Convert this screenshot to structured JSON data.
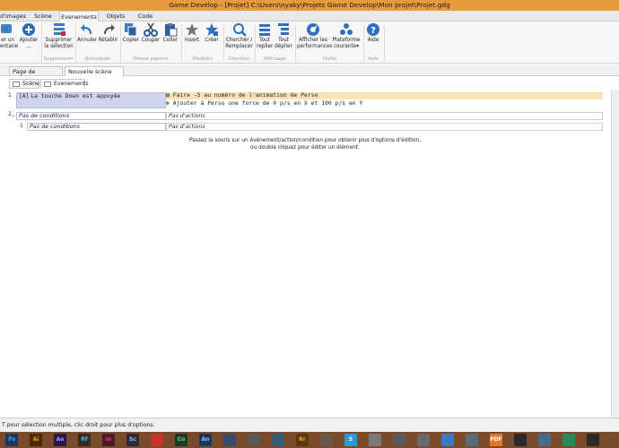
{
  "window": {
    "title": "Game Develop - [Projet] C:\\Users\\nyaky\\Projets Game Develop\\Mon projet\\Projet.gdg"
  },
  "menubar": {
    "tabs": [
      "d'images",
      "Scène",
      "Evenements",
      "Objets",
      "Code"
    ],
    "active": "Evenements"
  },
  "ribbon": {
    "buttons": {
      "ajouter_un_commentaire": [
        "er un",
        "entaire"
      ],
      "ajouter": [
        "Ajouter",
        "..."
      ],
      "supprimer": [
        "Supprimer",
        "la sélection"
      ],
      "annuler": [
        "Annuler"
      ],
      "retablir": [
        "Rétablir"
      ],
      "copier": [
        "Copier"
      ],
      "couper": [
        "Couper"
      ],
      "coller": [
        "Coller"
      ],
      "insert": [
        "Insert"
      ],
      "creer": [
        "Créer"
      ],
      "chercher": [
        "Chercher /",
        "Remplacer"
      ],
      "tout_replier": [
        "Tout",
        "replier"
      ],
      "tout_deplier": [
        "Tout",
        "déplier"
      ],
      "afficher_perf": [
        "Afficher les",
        "performances"
      ],
      "plateforme": [
        "Plateforme",
        "courante"
      ],
      "aide": [
        "Aide"
      ]
    },
    "groups": {
      "suppression": "Suppression",
      "annulation": "Annulation",
      "presse_papiers": "Presse papiers",
      "modeles": "Modèles",
      "chercher": "Chercher",
      "affichage": "Affichage",
      "outils": "Outils",
      "aide": "Aide"
    }
  },
  "doc_tabs": [
    "Page de démarrage",
    "Nouvelle scène"
  ],
  "sub_tabs": [
    "Scène",
    "Evenements"
  ],
  "events": [
    {
      "number": "1",
      "condition": "La touche Down est appuyée",
      "actions": [
        "Faire -5 au numéro de l'animation de Perso",
        "Ajouter à Perso une force de 0 p/s en X et 100 p/s en Y"
      ]
    },
    {
      "number": "2",
      "condition": "Pas de conditions",
      "actions": [
        "Pas d'actions"
      ],
      "sub_event": {
        "number": "1",
        "condition": "Pas de conditions",
        "action": "Pas d'actions"
      }
    }
  ],
  "hint": [
    "Passez la souris sur un évènement/action/condition pour obtenir plus d'options d'édition,",
    "ou double cliquez pour éditer un élément."
  ],
  "status": "T pour sélection multiple, clic droit pour plus d'options.",
  "taskbar": {
    "apps": [
      "Ps",
      "Ai",
      "Ae",
      "Rf",
      "In",
      "Sc",
      "",
      "Co",
      "An",
      "",
      "",
      "",
      "Br",
      "",
      "S",
      "",
      "",
      "",
      "",
      "",
      "PDF",
      "",
      "",
      "",
      ""
    ]
  },
  "colors": {
    "title_bar": "#e79a3c",
    "selection_action": "#fbe0b2",
    "selection_condition": "#cfd3f0",
    "taskbar": "#7a4a2a"
  }
}
